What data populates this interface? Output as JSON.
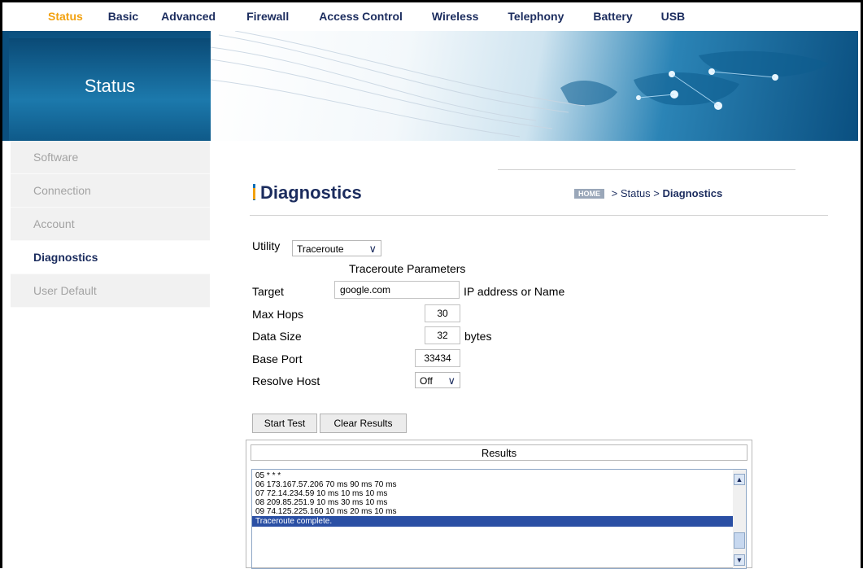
{
  "nav": {
    "items": [
      {
        "label": "Status",
        "active": true
      },
      {
        "label": "Basic",
        "active": false
      },
      {
        "label": "Advanced",
        "active": false
      },
      {
        "label": "Firewall",
        "active": false
      },
      {
        "label": "Access Control",
        "active": false
      },
      {
        "label": "Wireless",
        "active": false
      },
      {
        "label": "Telephony",
        "active": false
      },
      {
        "label": "Battery",
        "active": false
      },
      {
        "label": "USB",
        "active": false
      }
    ]
  },
  "banner": {
    "title": "Status"
  },
  "sidebar": {
    "items": [
      {
        "label": "Software",
        "active": false
      },
      {
        "label": "Connection",
        "active": false
      },
      {
        "label": "Account",
        "active": false
      },
      {
        "label": "Diagnostics",
        "active": true
      },
      {
        "label": "User Default",
        "active": false
      }
    ]
  },
  "page": {
    "title": "Diagnostics",
    "breadcrumb": {
      "home": "HOME",
      "path": " > Status > ",
      "current": "Diagnostics"
    }
  },
  "form": {
    "utility_label": "Utility",
    "utility_value": "Traceroute",
    "section_title": "Traceroute Parameters",
    "target_label": "Target",
    "target_value": "google.com",
    "target_hint": "IP address or Name",
    "maxhops_label": "Max Hops",
    "maxhops_value": "30",
    "datasize_label": "Data Size",
    "datasize_value": "32",
    "datasize_unit": "bytes",
    "baseport_label": "Base Port",
    "baseport_value": "33434",
    "resolve_label": "Resolve Host",
    "resolve_value": "Off"
  },
  "buttons": {
    "start": "Start Test",
    "clear": "Clear Results"
  },
  "results": {
    "title": "Results",
    "lines": [
      "05 * * *",
      "06 173.167.57.206 70 ms 90 ms 70 ms",
      "07 72.14.234.59 10 ms 10 ms 10 ms",
      "08 209.85.251.9 10 ms 30 ms 10 ms",
      "09 74.125.225.160 10 ms 20 ms 10 ms",
      "Traceroute complete."
    ]
  },
  "colors": {
    "accent": "#f2a10f",
    "navy": "#1b2c5e",
    "blue": "#0b4f7e"
  }
}
